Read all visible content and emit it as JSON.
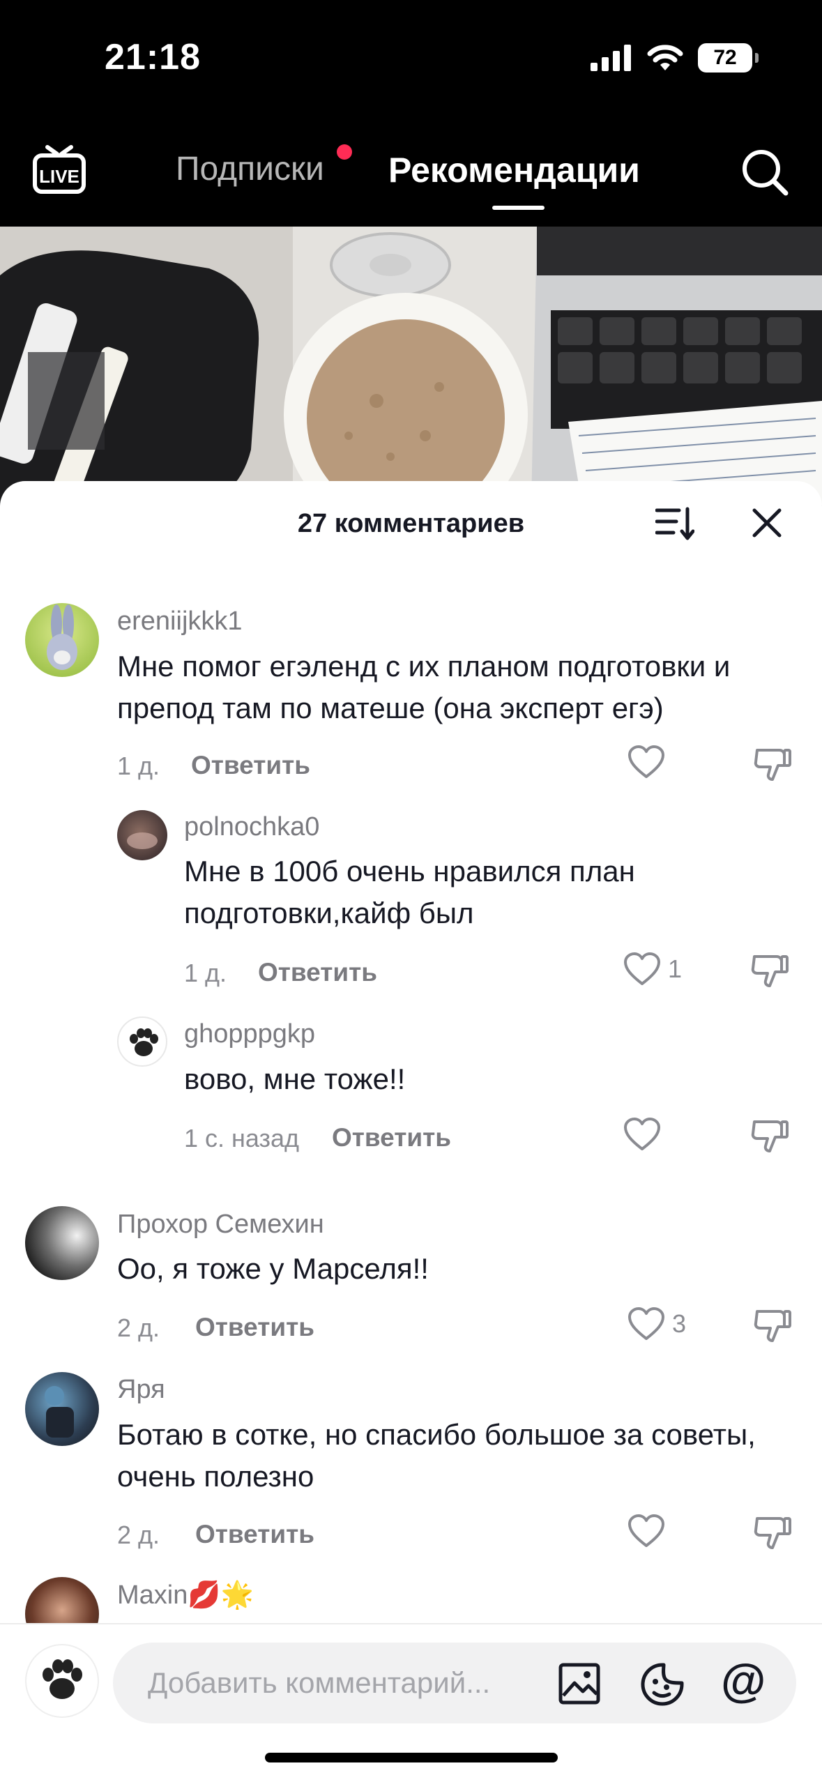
{
  "status_bar": {
    "time": "21:18",
    "battery": "72",
    "icons": [
      "cellular-signal-icon",
      "wifi-icon",
      "battery-icon"
    ]
  },
  "top_nav": {
    "live_icon": "live-tv-icon",
    "live_label": "LIVE",
    "tab_following": "Подписки",
    "tab_recommended": "Рекомендации",
    "search_icon": "search-icon",
    "notification_dot_color": "#fe2c55"
  },
  "comments_sheet": {
    "title": "27 комментариев",
    "sort_icon": "sort-icon",
    "close_icon": "close-icon",
    "reply_label": "Ответить",
    "comments": [
      {
        "username": "ereniijkkk1",
        "text": "Мне помог егэленд с их планом подготовки и препод там по матеше (она эксперт егэ)",
        "time": "1 д.",
        "likes": ""
      },
      {
        "username": "polnochka0",
        "text": "Мне в 100б очень нравился план подготовки,кайф был",
        "time": "1 д.",
        "likes": "1"
      },
      {
        "username": "ghopppgkp",
        "text": "вово, мне тоже!!",
        "time": "1 с. назад",
        "likes": ""
      },
      {
        "username": "Прохор Семехин",
        "text": "Оо, я тоже у Марселя!!",
        "time": "2 д.",
        "likes": "3"
      },
      {
        "username": "Яря",
        "text": "Ботаю в сотке, но спасибо большое за советы, очень полезно",
        "time": "2 д.",
        "likes": ""
      },
      {
        "username": "Maxin💋🌟",
        "text": "",
        "time": "",
        "likes": ""
      }
    ]
  },
  "bottom_bar": {
    "placeholder": "Добавить комментарий...",
    "icons": [
      "image-icon",
      "emoji-sticker-icon",
      "mention-icon"
    ],
    "mention_symbol": "@"
  }
}
